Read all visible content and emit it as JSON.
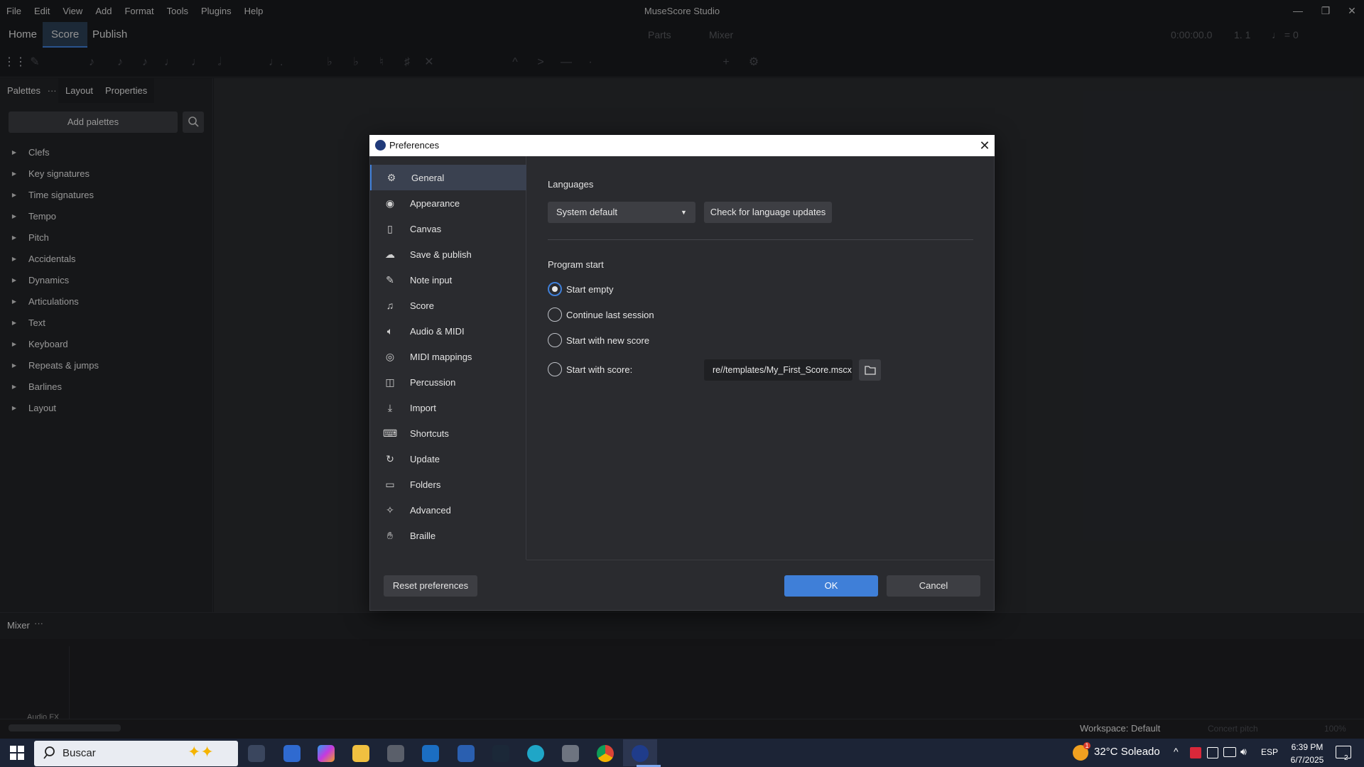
{
  "app": {
    "title": "MuseScore Studio"
  },
  "menu": [
    "File",
    "Edit",
    "View",
    "Add",
    "Format",
    "Tools",
    "Plugins",
    "Help"
  ],
  "top_tabs": {
    "home": "Home",
    "score": "Score",
    "publish": "Publish"
  },
  "toolbar_right": {
    "parts": "Parts",
    "mixer": "Mixer",
    "time": "0:00:00.0",
    "position": "1. 1",
    "tempo": "♩ = 0"
  },
  "left_panel": {
    "tabs": {
      "palettes": "Palettes",
      "layout": "Layout",
      "properties": "Properties"
    },
    "add_palettes": "Add palettes",
    "palettes": [
      "Clefs",
      "Key signatures",
      "Time signatures",
      "Tempo",
      "Pitch",
      "Accidentals",
      "Dynamics",
      "Articulations",
      "Text",
      "Keyboard",
      "Repeats & jumps",
      "Barlines",
      "Layout"
    ]
  },
  "mixer": {
    "label": "Mixer",
    "audio_fx": "Audio FX"
  },
  "status": {
    "workspace": "Workspace: Default",
    "concert_pitch": "Concert pitch",
    "zoom": "100%"
  },
  "taskbar": {
    "search_placeholder": "Buscar",
    "weather_temp": "32°C",
    "weather_text": "Soleado",
    "lang": "ESP",
    "time": "6:39 PM",
    "date": "6/7/2025",
    "notif_count": "2",
    "weather_badge": "1"
  },
  "dialog": {
    "title": "Preferences",
    "sections": [
      {
        "label": "General",
        "icon": "gear-icon"
      },
      {
        "label": "Appearance",
        "icon": "eye-icon"
      },
      {
        "label": "Canvas",
        "icon": "page-icon"
      },
      {
        "label": "Save & publish",
        "icon": "cloud-icon"
      },
      {
        "label": "Note input",
        "icon": "pencil-icon"
      },
      {
        "label": "Score",
        "icon": "score-icon"
      },
      {
        "label": "Audio & MIDI",
        "icon": "speaker-icon"
      },
      {
        "label": "MIDI mappings",
        "icon": "midi-icon"
      },
      {
        "label": "Percussion",
        "icon": "drum-icon"
      },
      {
        "label": "Import",
        "icon": "import-icon"
      },
      {
        "label": "Shortcuts",
        "icon": "keyboard-icon"
      },
      {
        "label": "Update",
        "icon": "refresh-icon"
      },
      {
        "label": "Folders",
        "icon": "folder-icon"
      },
      {
        "label": "Advanced",
        "icon": "wrench-icon"
      },
      {
        "label": "Braille",
        "icon": "hand-icon"
      }
    ],
    "languages_label": "Languages",
    "language_value": "System default",
    "check_updates": "Check for language updates",
    "program_start_label": "Program start",
    "options": [
      "Start empty",
      "Continue last session",
      "Start with new score",
      "Start with score:"
    ],
    "selected_option": "Start empty",
    "score_path": "re//templates/My_First_Score.mscx",
    "reset": "Reset preferences",
    "ok": "OK",
    "cancel": "Cancel"
  },
  "colors": {
    "accent": "#3f7fd8",
    "background": "#2a2b2f",
    "taskbar": "#1c2436"
  }
}
